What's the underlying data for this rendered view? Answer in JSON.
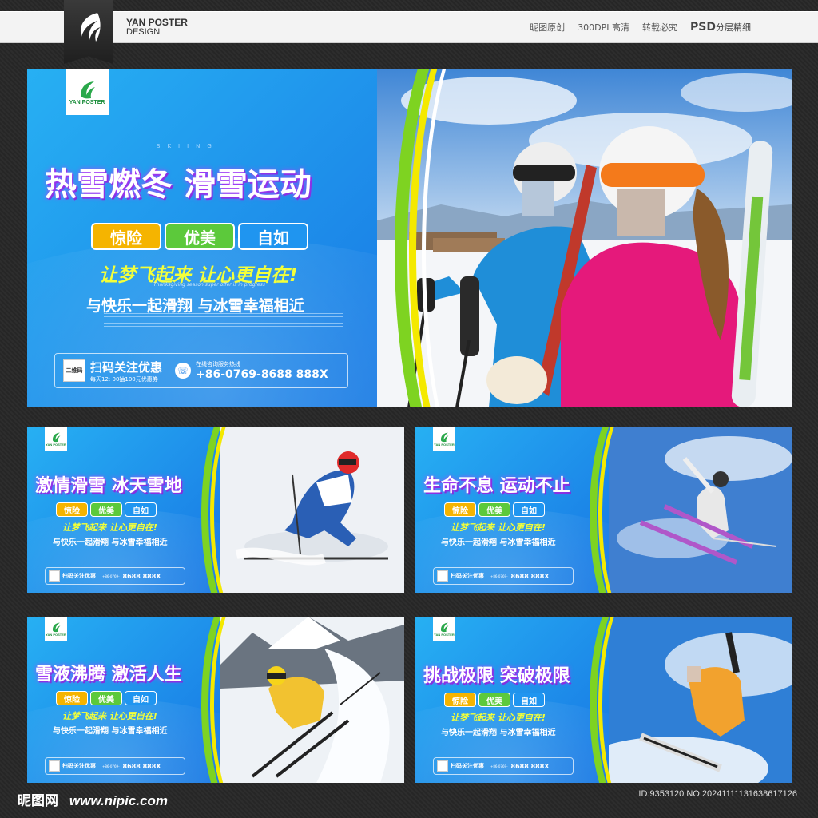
{
  "header": {
    "brand_line1": "YAN POSTER",
    "brand_line2": "DESIGN",
    "links": [
      "昵图原创",
      "300DPI 高清",
      "转载必究"
    ],
    "psd_big": "PSD",
    "psd_small": "分层精细"
  },
  "logo_text": "YAN POSTER",
  "pills": [
    "惊险",
    "优美",
    "自如"
  ],
  "slogan": "让梦飞起来 让心更自在!",
  "slogan_small": "让梦飞起来 让心更自在!",
  "sub_en": "Thanksgiving season super offer is in progress",
  "line2": "与快乐一起滑翔 与冰雪幸福相近",
  "skiing": "SKIING",
  "scan_title": "扫码关注优惠",
  "scan_sub": "每天12: 00抽100元优惠券",
  "qr_label": "二维码",
  "hotline_label": "在线咨询服务热线",
  "hotline": "+86-0769-8688 888X",
  "hotline_small_prefix": "+86-0769-",
  "hotline_small_num": "8688 888X",
  "posters": [
    {
      "headline": "热雪燃冬 滑雪运动"
    },
    {
      "headline": "激情滑雪 冰天雪地"
    },
    {
      "headline": "生命不息 运动不止"
    },
    {
      "headline": "雪液沸腾 激活人生"
    },
    {
      "headline": "挑战极限 突破极限"
    }
  ],
  "footer": {
    "site_cn": "昵图网",
    "site_url": "www.nipic.com",
    "id_line": "ID:9353120 NO:20241111131638617126"
  },
  "colors": {
    "poster_blue": "#1a7fe6",
    "arc_green": "#7ed321",
    "arc_yellow": "#f4e900",
    "pill_yellow": "#f5b400",
    "pill_green": "#5cc93b",
    "slogan_yellow": "#f3ff3a"
  }
}
